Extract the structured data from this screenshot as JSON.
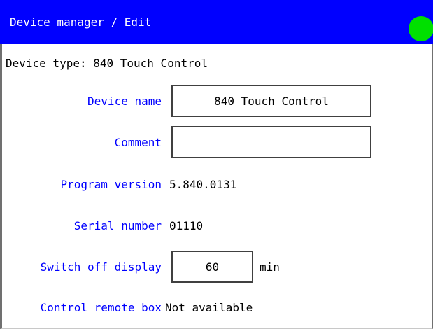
{
  "header": {
    "title": "Device manager / Edit",
    "status_indicator": {
      "icon": "status-dot-icon",
      "color": "#00e000"
    }
  },
  "device_type": "Device type: 840 Touch Control",
  "form": {
    "device_name": {
      "label": "Device name",
      "value": "840 Touch Control"
    },
    "comment": {
      "label": "Comment",
      "value": ""
    },
    "program_version": {
      "label": "Program version",
      "value": "5.840.0131"
    },
    "serial_number": {
      "label": "Serial number",
      "value": "01110"
    },
    "switch_off_display": {
      "label": "Switch off display",
      "value": "60",
      "unit": "min"
    },
    "control_remote_box": {
      "label": "Control remote box",
      "value": "Not available"
    }
  },
  "colors": {
    "header_bg": "#0000ff",
    "label": "#0000ff",
    "status_ok": "#00e000"
  }
}
